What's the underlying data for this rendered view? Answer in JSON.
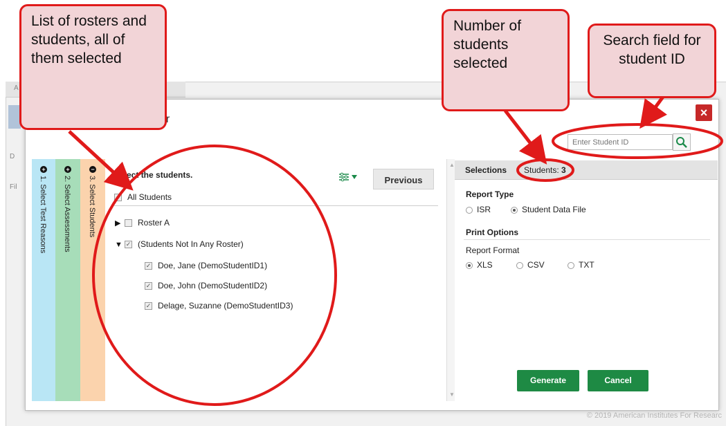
{
  "background": {
    "letters": [
      "A",
      "D",
      "Fil"
    ],
    "copyright": "© 2019 American Institutes For Researc"
  },
  "modal": {
    "title_fragment": "or",
    "close_symbol": "×",
    "search": {
      "placeholder": "Enter Student ID"
    },
    "steps": [
      {
        "number": "+",
        "label": "1. Select Test Reasons",
        "color": "#b9e6f5"
      },
      {
        "number": "+",
        "label": "2. Select Assessments",
        "color": "#a7ddb9"
      },
      {
        "number": "−",
        "label": "3. Select Students",
        "color": "#fbd3ad"
      }
    ],
    "student_selector": {
      "heading": "Select the students.",
      "filter_icon": "filter-sliders-icon",
      "previous_label": "Previous",
      "all_students_label": "All Students",
      "rows": [
        {
          "label": "Roster A",
          "expander": "▶",
          "checked": false
        },
        {
          "label": "(Students Not In Any Roster)",
          "expander": "▼",
          "checked": true
        },
        {
          "label": "Doe, Jane (DemoStudentID1)",
          "checked": true
        },
        {
          "label": "Doe, John (DemoStudentID2)",
          "checked": true
        },
        {
          "label": "Delage, Suzanne (DemoStudentID3)",
          "checked": true
        }
      ]
    },
    "selections": {
      "title": "Selections",
      "count_text": "Students: ",
      "count": "3",
      "report_type_label": "Report Type",
      "report_type_options": [
        {
          "label": "ISR",
          "selected": false
        },
        {
          "label": "Student Data File",
          "selected": true
        }
      ],
      "print_options_label": "Print Options",
      "report_format_label": "Report Format",
      "report_format_options": [
        {
          "label": "XLS",
          "selected": true
        },
        {
          "label": "CSV",
          "selected": false
        },
        {
          "label": "TXT",
          "selected": false
        }
      ],
      "generate_label": "Generate",
      "cancel_label": "Cancel",
      "button_color": "#1e8a44"
    }
  },
  "callouts": {
    "rosters": "List of rosters and students, all of them selected",
    "count": "Number of students selected",
    "search": "Search field for student ID",
    "color": "#e01a1a"
  }
}
